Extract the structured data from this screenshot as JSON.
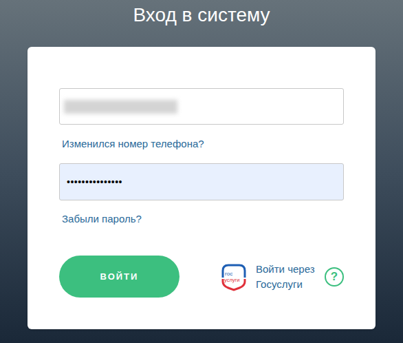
{
  "page": {
    "title": "Вход в систему"
  },
  "phone_field": {
    "value_hidden": true
  },
  "phone_change_link": "Изменился номер телефона?",
  "password_field": {
    "value": "•••••••••••••••"
  },
  "forgot_link": "Забыли пароль?",
  "login_button": "ВОЙТИ",
  "gosuslugi": {
    "logo_lines": [
      "гос",
      "услуги"
    ],
    "label": "Войти через Госуслуги"
  },
  "help": "?"
}
